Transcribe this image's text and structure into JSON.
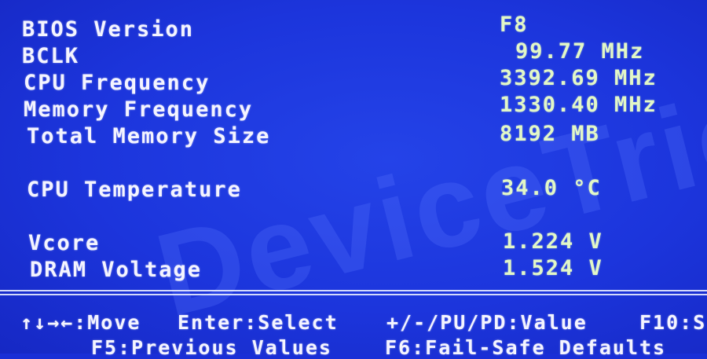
{
  "watermark": "DeviceTricks",
  "info": [
    {
      "label": "BIOS Version",
      "value": "F8"
    },
    {
      "label": "BCLK",
      "value": "99.77 MHz"
    },
    {
      "label": "CPU Frequency",
      "value": "3392.69 MHz"
    },
    {
      "label": "Memory Frequency",
      "value": "1330.40 MHz"
    },
    {
      "label": "Total Memory Size",
      "value": "8192 MB"
    },
    {
      "label": "CPU Temperature",
      "value": "34.0 °C"
    },
    {
      "label": "Vcore",
      "value": "1.224 V"
    },
    {
      "label": "DRAM Voltage",
      "value": "1.524 V"
    }
  ],
  "footer": {
    "move": "↑↓→←:Move",
    "select": "Enter:Select",
    "value": "+/-/PU/PD:Value",
    "f10": "F10:S",
    "f5": "F5:Previous Values",
    "f6": "F6:Fail-Safe Defaults"
  },
  "colors": {
    "background": "#1a2fd6",
    "label_text": "#f4f4ff",
    "value_text": "#e2f7c7"
  }
}
